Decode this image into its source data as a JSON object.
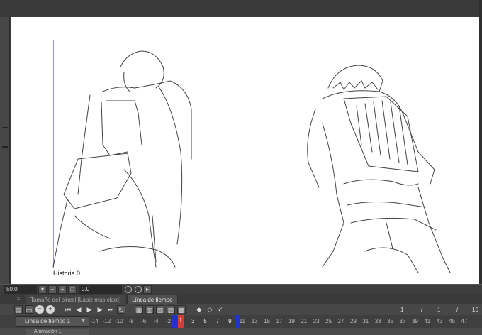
{
  "canvas": {
    "history_label": "Historia 0"
  },
  "toolbar": {
    "zoom_value": "50.0",
    "angle_value": "0.0"
  },
  "tabs": [
    {
      "label": "Tamaño del pincel [Lápiz más claro]",
      "active": false
    },
    {
      "label": "Línea de tiempo",
      "active": true
    }
  ],
  "frame_counter": {
    "current": "1",
    "separator1": "/",
    "start": "1",
    "separator2": "/",
    "end": "10"
  },
  "timeline": {
    "name": "Línea de tiempo 1",
    "layer_name": "Animación 1",
    "ruler_labels": [
      "-14",
      "-12",
      "-10",
      "-8",
      "-6",
      "-4",
      "-2",
      "1",
      "3",
      "5",
      "7",
      "9",
      "11",
      "13",
      "15",
      "17",
      "19",
      "21",
      "23",
      "25",
      "27",
      "29",
      "31",
      "33",
      "35",
      "37",
      "39",
      "41",
      "43",
      "45",
      "47"
    ],
    "playhead_frame": "1",
    "accent_in": "#2233cc",
    "accent_playhead": "#d83a3a"
  },
  "icons": [
    "pencil-icon",
    "lock-icon",
    "camera-icon",
    "arrow-left-icon",
    "play-icon",
    "arrow-right-icon",
    "loop-icon",
    "cel-icon",
    "key-icon",
    "check-icon"
  ]
}
